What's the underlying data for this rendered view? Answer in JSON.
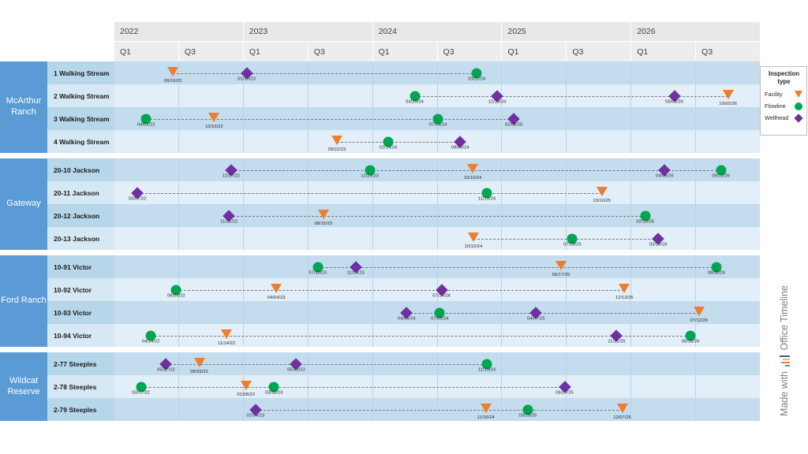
{
  "timeline": {
    "start": "2022-01-01",
    "end": "2026-12-31",
    "header": {
      "years": [
        "2022",
        "2023",
        "2024",
        "2025",
        "2026"
      ],
      "quarters": [
        "Q1",
        "Q3",
        "Q1",
        "Q3",
        "Q1",
        "Q3",
        "Q1",
        "Q3",
        "Q1",
        "Q3"
      ]
    }
  },
  "legend": {
    "title": "Inspection type",
    "items": [
      {
        "label": "Facility",
        "icon": "triangle-down-icon",
        "color": "#ed7d31"
      },
      {
        "label": "Flowline",
        "icon": "circle-icon",
        "color": "#00a650"
      },
      {
        "label": "Wellhead",
        "icon": "diamond-icon",
        "color": "#7030a0"
      }
    ]
  },
  "branding": {
    "prefix": "Made with",
    "name": "Office Timeline",
    "logo": "office-timeline-logo-icon"
  },
  "groups": [
    {
      "name": "McArthur Ranch",
      "rows": [
        {
          "name": "1 Walking Stream",
          "milestones": [
            {
              "date": "06/16/22",
              "type": "facility"
            },
            {
              "date": "01/10/23",
              "type": "wellhead"
            },
            {
              "date": "10/21/24",
              "type": "flowline"
            }
          ]
        },
        {
          "name": "2 Walking Stream",
          "milestones": [
            {
              "date": "04/29/24",
              "type": "flowline"
            },
            {
              "date": "12/18/24",
              "type": "wellhead"
            },
            {
              "date": "05/03/26",
              "type": "wellhead"
            },
            {
              "date": "10/02/26",
              "type": "facility"
            }
          ]
        },
        {
          "name": "3 Walking Stream",
          "milestones": [
            {
              "date": "04/01/22",
              "type": "flowline"
            },
            {
              "date": "10/10/22",
              "type": "facility"
            },
            {
              "date": "07/04/24",
              "type": "flowline"
            },
            {
              "date": "02/03/25",
              "type": "wellhead"
            }
          ]
        },
        {
          "name": "4 Walking Stream",
          "milestones": [
            {
              "date": "09/22/23",
              "type": "facility"
            },
            {
              "date": "02/14/24",
              "type": "flowline"
            },
            {
              "date": "09/05/24",
              "type": "wellhead"
            }
          ]
        }
      ]
    },
    {
      "name": "Gateway",
      "rows": [
        {
          "name": "20-10 Jackson",
          "milestones": [
            {
              "date": "11/27/22",
              "type": "wellhead"
            },
            {
              "date": "12/24/23",
              "type": "flowline"
            },
            {
              "date": "10/10/24",
              "type": "facility"
            },
            {
              "date": "04/06/26",
              "type": "wellhead"
            },
            {
              "date": "09/12/26",
              "type": "flowline"
            }
          ]
        },
        {
          "name": "20-11 Jackson",
          "milestones": [
            {
              "date": "03/07/22",
              "type": "wellhead"
            },
            {
              "date": "11/19/24",
              "type": "flowline"
            },
            {
              "date": "10/10/25",
              "type": "facility"
            }
          ]
        },
        {
          "name": "20-12 Jackson",
          "milestones": [
            {
              "date": "11/21/22",
              "type": "wellhead"
            },
            {
              "date": "08/15/23",
              "type": "facility"
            },
            {
              "date": "02/10/26",
              "type": "flowline"
            }
          ]
        },
        {
          "name": "20-13 Jackson",
          "milestones": [
            {
              "date": "10/12/24",
              "type": "facility"
            },
            {
              "date": "07/19/25",
              "type": "flowline"
            },
            {
              "date": "03/19/26",
              "type": "wellhead"
            }
          ]
        }
      ]
    },
    {
      "name": "Ford Ranch",
      "rows": [
        {
          "name": "10-91 Victor",
          "milestones": [
            {
              "date": "07/30/23",
              "type": "flowline"
            },
            {
              "date": "11/14/23",
              "type": "wellhead"
            },
            {
              "date": "06/17/25",
              "type": "facility"
            },
            {
              "date": "08/30/26",
              "type": "flowline"
            }
          ]
        },
        {
          "name": "10-92 Victor",
          "milestones": [
            {
              "date": "06/25/22",
              "type": "flowline"
            },
            {
              "date": "04/04/23",
              "type": "facility"
            },
            {
              "date": "07/14/24",
              "type": "wellhead"
            },
            {
              "date": "12/13/25",
              "type": "facility"
            }
          ]
        },
        {
          "name": "10-93 Victor",
          "milestones": [
            {
              "date": "04/06/24",
              "type": "wellhead"
            },
            {
              "date": "07/09/24",
              "type": "flowline"
            },
            {
              "date": "04/07/25",
              "type": "wellhead"
            },
            {
              "date": "07/12/26",
              "type": "facility"
            }
          ]
        },
        {
          "name": "10-94 Victor",
          "milestones": [
            {
              "date": "04/14/22",
              "type": "flowline"
            },
            {
              "date": "11/14/22",
              "type": "facility"
            },
            {
              "date": "11/21/25",
              "type": "wellhead"
            },
            {
              "date": "06/18/26",
              "type": "flowline"
            }
          ]
        }
      ]
    },
    {
      "name": "Wildcat Reserve",
      "rows": [
        {
          "name": "2-77 Steeples",
          "milestones": [
            {
              "date": "05/27/22",
              "type": "wellhead"
            },
            {
              "date": "08/29/22",
              "type": "facility"
            },
            {
              "date": "05/30/23",
              "type": "wellhead"
            },
            {
              "date": "11/19/24",
              "type": "flowline"
            }
          ]
        },
        {
          "name": "2-78 Steeples",
          "milestones": [
            {
              "date": "03/17/22",
              "type": "flowline"
            },
            {
              "date": "01/08/23",
              "type": "facility"
            },
            {
              "date": "03/28/23",
              "type": "flowline"
            },
            {
              "date": "06/27/25",
              "type": "wellhead"
            }
          ]
        },
        {
          "name": "2-79 Steeples",
          "milestones": [
            {
              "date": "02/04/23",
              "type": "wellhead"
            },
            {
              "date": "11/16/24",
              "type": "facility"
            },
            {
              "date": "03/15/25",
              "type": "flowline"
            },
            {
              "date": "12/07/25",
              "type": "facility"
            }
          ]
        }
      ]
    }
  ]
}
